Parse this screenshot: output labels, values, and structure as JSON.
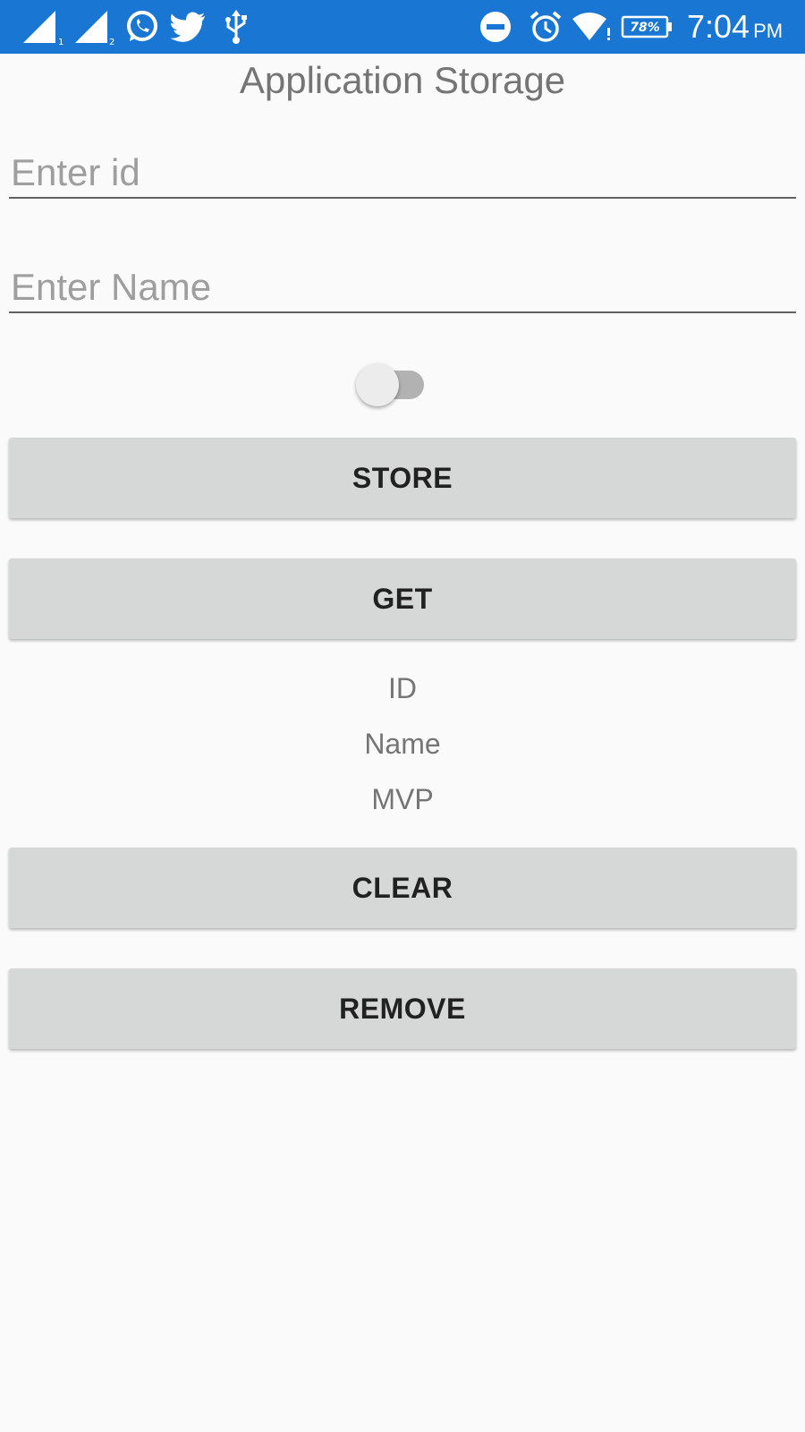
{
  "status_bar": {
    "background": "#1976d2",
    "sim1_index": "1",
    "sim2_index": "2",
    "battery_text": "78%",
    "time": "7:04",
    "ampm": "PM",
    "icons": [
      "signal-sim1-icon",
      "signal-sim2-icon",
      "whatsapp-icon",
      "twitter-icon",
      "usb-icon",
      "do-not-disturb-icon",
      "alarm-icon",
      "wifi-icon",
      "battery-icon"
    ]
  },
  "page": {
    "title": "Application Storage"
  },
  "form": {
    "id_placeholder": "Enter id",
    "id_value": "",
    "name_placeholder": "Enter Name",
    "name_value": "",
    "switch_on": false
  },
  "buttons": {
    "store": "STORE",
    "get": "GET",
    "clear": "CLEAR",
    "remove": "REMOVE"
  },
  "output": {
    "id_label": "ID",
    "name_label": "Name",
    "mvp_label": "MVP"
  }
}
